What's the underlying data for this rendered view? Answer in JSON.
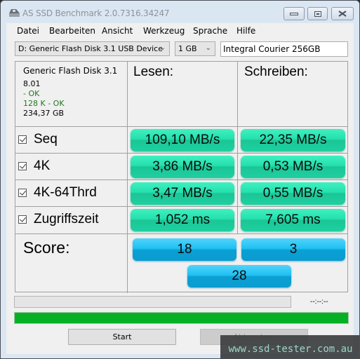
{
  "window": {
    "title": "AS SSD Benchmark 2.0.7316.34247",
    "app_icon": "drive-icon",
    "controls": {
      "minimize": "minimize-icon",
      "maximize": "maximize-icon",
      "close": "close-icon"
    }
  },
  "menu": [
    "Datei",
    "Bearbeiten",
    "Ansicht",
    "Werkzeug",
    "Sprache",
    "Hilfe"
  ],
  "toolbar": {
    "drive_select": "D: Generic Flash Disk 3.1 USB Device",
    "size_select": "1 GB",
    "device_name_value": "Integral Courier 256GB"
  },
  "drive_info": {
    "name": "Generic Flash Disk 3.1",
    "firmware": "8.01",
    "driver_status": " - OK",
    "alignment_status": "128 K - OK",
    "capacity": "234,37 GB"
  },
  "columns": {
    "read": "Lesen:",
    "write": "Schreiben:"
  },
  "tests": [
    {
      "label": "Seq",
      "checked": true,
      "read": "109,10 MB/s",
      "write": "22,35 MB/s"
    },
    {
      "label": "4K",
      "checked": true,
      "read": "3,86 MB/s",
      "write": "0,53 MB/s"
    },
    {
      "label": "4K-64Thrd",
      "checked": true,
      "read": "3,47 MB/s",
      "write": "0,55 MB/s"
    },
    {
      "label": "Zugriffszeit",
      "checked": true,
      "read": "1,052 ms",
      "write": "7,605 ms"
    }
  ],
  "score": {
    "label": "Score:",
    "read": "18",
    "write": "3",
    "total": "28"
  },
  "progress": {
    "test_progress_percent": 0,
    "timer": "--:--:--",
    "overall_progress_percent": 100,
    "colors": {
      "fill": "#06b025"
    }
  },
  "buttons": {
    "start": "Start",
    "abort": "Abbrechen"
  },
  "colors": {
    "result_green": "#23e0ad",
    "score_blue": "#21c0f2"
  },
  "watermark": "www.ssd-tester.com.au"
}
